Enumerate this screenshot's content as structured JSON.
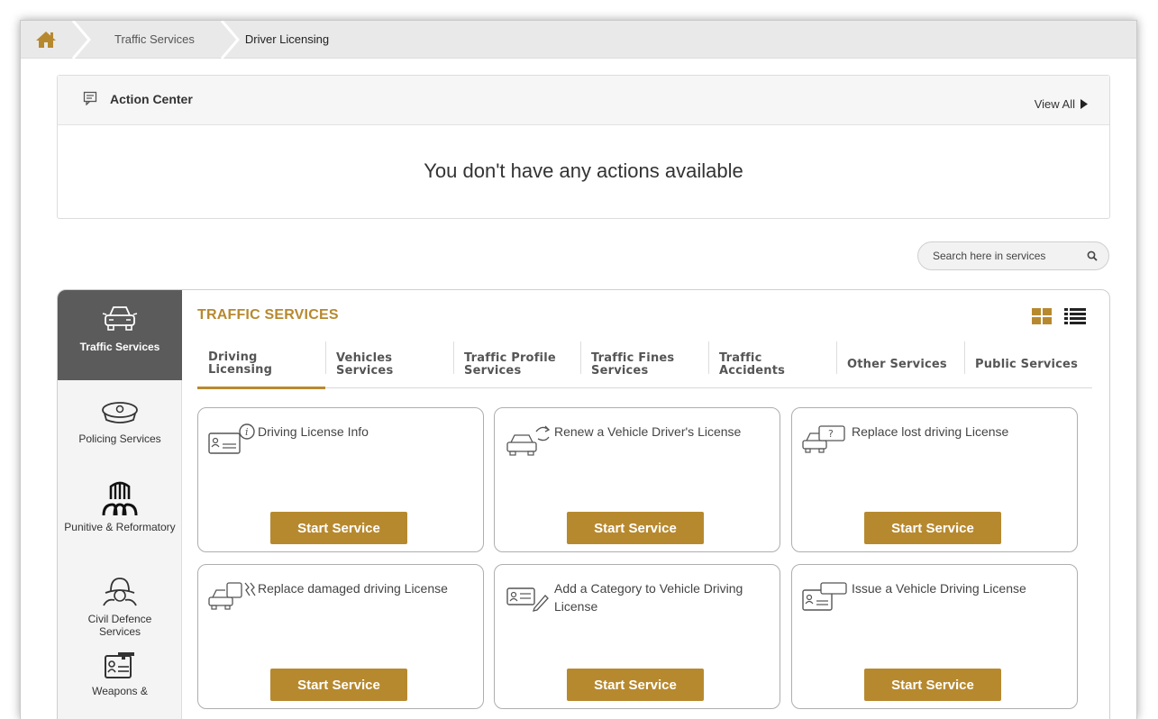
{
  "breadcrumb": {
    "items": [
      {
        "label": "Traffic Services"
      },
      {
        "label": "Driver Licensing"
      }
    ]
  },
  "action_center": {
    "title": "Action Center",
    "view_all": "View All",
    "empty_message": "You don't have any actions available"
  },
  "search": {
    "placeholder": "Search here in services"
  },
  "sidebar": {
    "items": [
      {
        "label": "Traffic Services",
        "icon": "car-icon",
        "active": true
      },
      {
        "label": "Policing Services",
        "icon": "police-cap-icon"
      },
      {
        "label": "Punitive & Reformatory",
        "icon": "prison-icon"
      },
      {
        "label": "Civil Defence Services",
        "icon": "firefighter-icon"
      },
      {
        "label": "Weapons &",
        "icon": "weapon-license-icon"
      }
    ]
  },
  "section": {
    "title": "TRAFFIC SERVICES"
  },
  "tabs": [
    {
      "line1": "Driving",
      "line2": "Licensing",
      "active": true
    },
    {
      "line1": "Vehicles",
      "line2": "Services"
    },
    {
      "line1": "Traffic Profile",
      "line2": "Services"
    },
    {
      "line1": "Traffic Fines",
      "line2": "Services"
    },
    {
      "line1": "Traffic",
      "line2": "Accidents"
    },
    {
      "line1": "Other Services",
      "line2": ""
    },
    {
      "line1": "Public Services",
      "line2": ""
    }
  ],
  "cards": [
    {
      "title": "Driving License Info",
      "button": "Start Service",
      "icon": "license-info-icon"
    },
    {
      "title": "Renew a Vehicle Driver's License",
      "button": "Start Service",
      "icon": "renew-license-icon"
    },
    {
      "title": "Replace lost driving License",
      "button": "Start Service",
      "icon": "lost-license-icon"
    },
    {
      "title": "Replace damaged driving License",
      "button": "Start Service",
      "icon": "damaged-license-icon"
    },
    {
      "title": "Add a Category to Vehicle Driving License",
      "button": "Start Service",
      "icon": "add-category-icon"
    },
    {
      "title": "Issue a Vehicle Driving License",
      "button": "Start Service",
      "icon": "new-license-icon"
    }
  ],
  "colors": {
    "accent": "#b7892f",
    "sidebar_active": "#5b5b5b",
    "home_icon": "#b7892f"
  }
}
